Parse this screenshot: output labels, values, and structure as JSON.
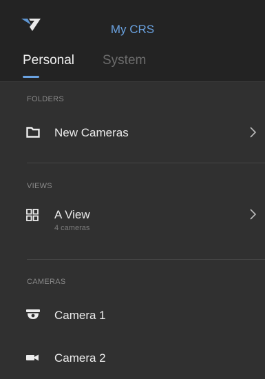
{
  "header": {
    "title": "My CRS",
    "logo_icon": "crs-logo-icon"
  },
  "tabs": [
    {
      "label": "Personal",
      "selected": true
    },
    {
      "label": "System",
      "selected": false
    }
  ],
  "sections": {
    "folders": {
      "label": "FOLDERS",
      "items": [
        {
          "label": "New Cameras",
          "icon": "folder-icon"
        }
      ]
    },
    "views": {
      "label": "VIEWS",
      "items": [
        {
          "label": "A View",
          "sublabel": "4 cameras",
          "icon": "grid-view-icon"
        }
      ]
    },
    "cameras": {
      "label": "CAMERAS",
      "items": [
        {
          "label": "Camera 1",
          "icon": "dome-camera-icon"
        },
        {
          "label": "Camera 2",
          "icon": "video-camera-icon"
        }
      ]
    }
  },
  "colors": {
    "accent": "#6aa2e0",
    "header_bg": "#232323",
    "content_bg": "#303030"
  }
}
